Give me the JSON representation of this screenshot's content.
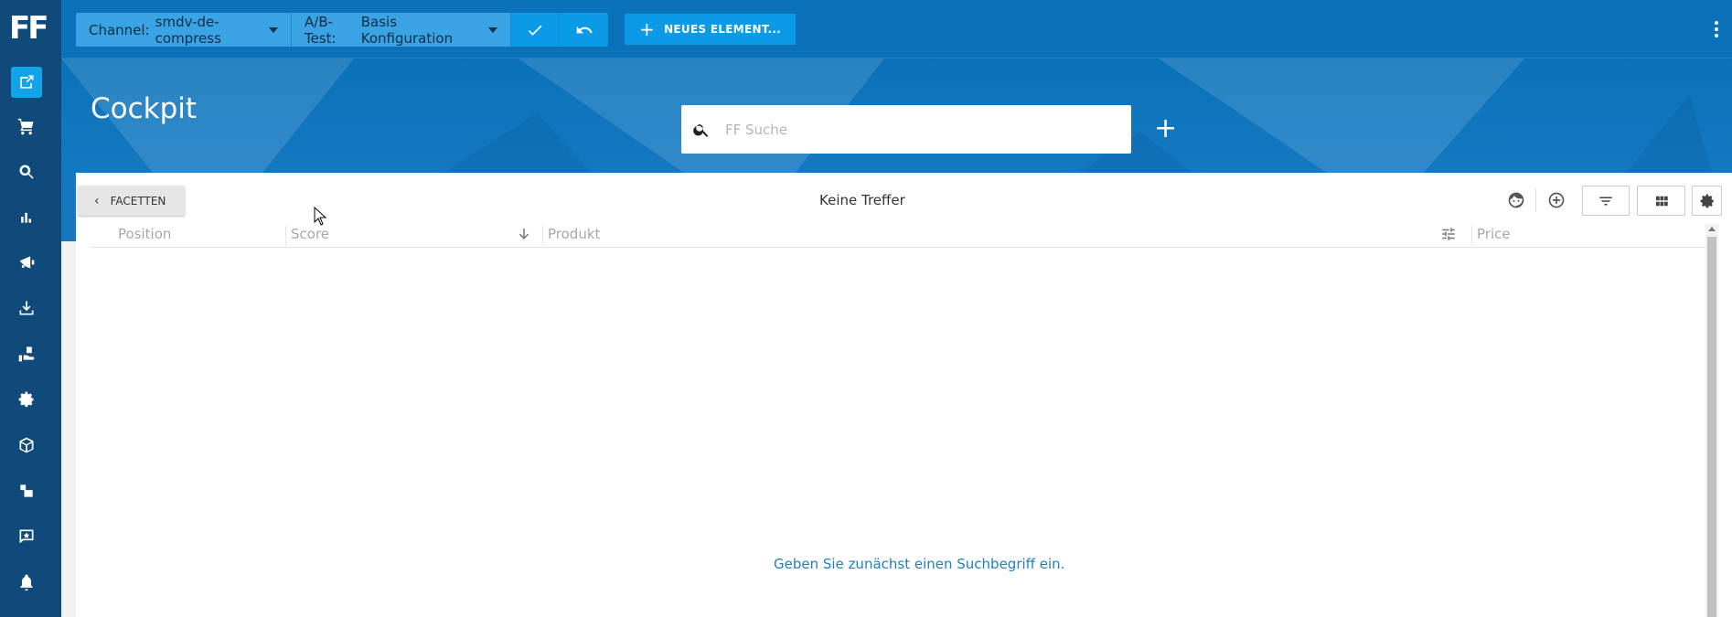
{
  "app": {
    "logo": "FF"
  },
  "sidebar": {
    "items": [
      {
        "name": "cockpit",
        "icon": "cockpit-icon",
        "active": true
      },
      {
        "name": "shopping",
        "icon": "shopping-cart-icon"
      },
      {
        "name": "search-settings",
        "icon": "search-gear-icon"
      },
      {
        "name": "analytics",
        "icon": "bar-chart-icon"
      },
      {
        "name": "campaigns",
        "icon": "megaphone-icon"
      },
      {
        "name": "import",
        "icon": "download-icon"
      },
      {
        "name": "recommendations",
        "icon": "hand-icon"
      },
      {
        "name": "settings",
        "icon": "gear-icon"
      },
      {
        "name": "products",
        "icon": "box-icon"
      },
      {
        "name": "layout",
        "icon": "blocks-icon"
      },
      {
        "name": "feedback",
        "icon": "star-chat-icon"
      },
      {
        "name": "notifications",
        "icon": "bell-icon"
      }
    ]
  },
  "toolbar": {
    "channel_label": "Channel:",
    "channel_value": "smdv-de-compress",
    "abtest_label": "A/B-Test:",
    "abtest_value": "Basis Konfiguration",
    "new_element_label": "NEUES ELEMENT..."
  },
  "page": {
    "title": "Cockpit",
    "search_placeholder": "FF Suche",
    "search_value": ""
  },
  "results": {
    "facets_label": "FACETTEN",
    "status": "Keine Treffer",
    "columns": [
      "Position",
      "Score",
      "Produkt",
      "Price"
    ],
    "empty_message": "Geben Sie zunächst einen Suchbegriff ein."
  },
  "colors": {
    "sidebar": "#0f4a7a",
    "header": "#0b72b9",
    "accent": "#0a9ae6",
    "link": "#1f7fc0"
  }
}
